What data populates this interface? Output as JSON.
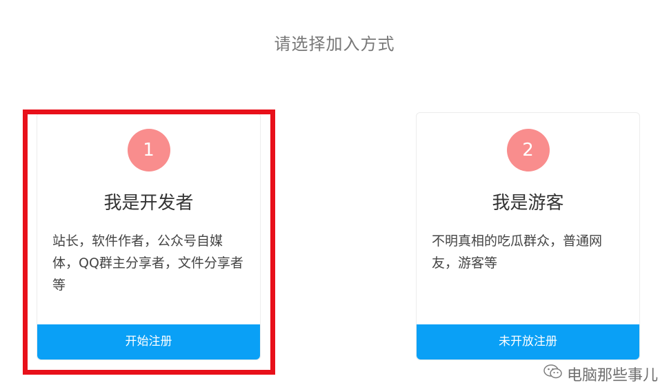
{
  "page": {
    "title": "请选择加入方式"
  },
  "cards": [
    {
      "number": "1",
      "title": "我是开发者",
      "description": "站长，软件作者，公众号自媒体，QQ群主分享者，文件分享者等",
      "button_label": "开始注册"
    },
    {
      "number": "2",
      "title": "我是游客",
      "description": "不明真相的吃瓜群众，普通网友，游客等",
      "button_label": "未开放注册"
    }
  ],
  "colors": {
    "accent_blue": "#0aa0f6",
    "step_circle": "#f98d8d",
    "highlight_red": "#e8101a"
  },
  "watermark": {
    "text": "电脑那些事儿",
    "icon": "wechat-icon"
  }
}
